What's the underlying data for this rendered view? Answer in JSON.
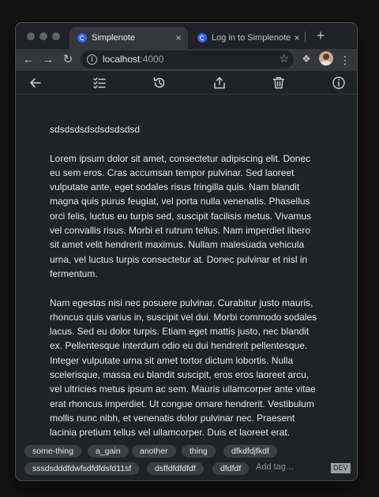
{
  "browser": {
    "tabs": [
      {
        "title": "Simplenote",
        "active": true
      },
      {
        "title": "Log in to Simplenote",
        "active": false
      }
    ],
    "close_glyph": "×",
    "new_tab_glyph": "+",
    "url": {
      "host": "localhost",
      "port": ":4000"
    },
    "icons": [
      "back-icon",
      "forward-icon",
      "reload-icon",
      "site-info-icon",
      "bookmark-star-icon",
      "extensions-icon",
      "profile-avatar",
      "menu-kebab-icon"
    ]
  },
  "app_toolbar": {
    "icons": [
      "back-arrow-icon",
      "checklist-icon",
      "history-icon",
      "share-icon",
      "trash-icon",
      "info-icon"
    ]
  },
  "note": {
    "title": "sdsdsdsdsdsdsdsdsd",
    "paragraphs": [
      "Lorem ipsum dolor sit amet, consectetur adipiscing elit. Donec eu sem eros. Cras accumsan tempor pulvinar. Sed laoreet vulputate ante, eget sodales risus fringilla quis. Nam blandit magna quis purus feugiat, vel porta nulla venenatis. Phasellus orci felis, luctus eu turpis sed, suscipit facilisis metus. Vivamus vel convallis risus. Morbi et rutrum tellus. Nam imperdiet libero sit amet velit hendrerit maximus. Nullam malesuada vehicula urna, vel luctus turpis consectetur at. Donec pulvinar et nisl in fermentum.",
      "Nam egestas nisi nec posuere pulvinar. Curabitur justo mauris, rhoncus quis varius in, suscipit vel dui. Morbi commodo sodales lacus. Sed eu dolor turpis. Etiam eget mattis justo, nec blandit ex. Pellentesque interdum odio eu dui hendrerit pellentesque. Integer vulputate urna sit amet tortor dictum lobortis. Nulla scelerisque, massa eu blandit suscipit, eros eros laoreet arcu, vel ultricies metus ipsum ac sem. Mauris ullamcorper ante vitae erat rhoncus imperdiet. Ut congue ornare hendrerit. Vestibulum mollis nunc nibh, et venenatis dolor pulvinar nec. Praesent lacinia pretium tellus vel ullamcorper. Duis et laoreet erat. Phasellus aliquam dictum"
    ]
  },
  "tags": [
    "some-thing",
    "a_gain",
    "another",
    "thing",
    "dfkdfdjfkdf",
    "sssdsdddfdwfsdfdfdsfd11sf",
    "dsffdfdfdfdf",
    "dfdfdf"
  ],
  "add_tag_placeholder": "Add tag…",
  "dev_badge": "DEV",
  "colors": {
    "background": "#1f2325",
    "text": "#e6e8ea",
    "tag_bg": "#3a3f43",
    "accent": "#3360ff"
  }
}
